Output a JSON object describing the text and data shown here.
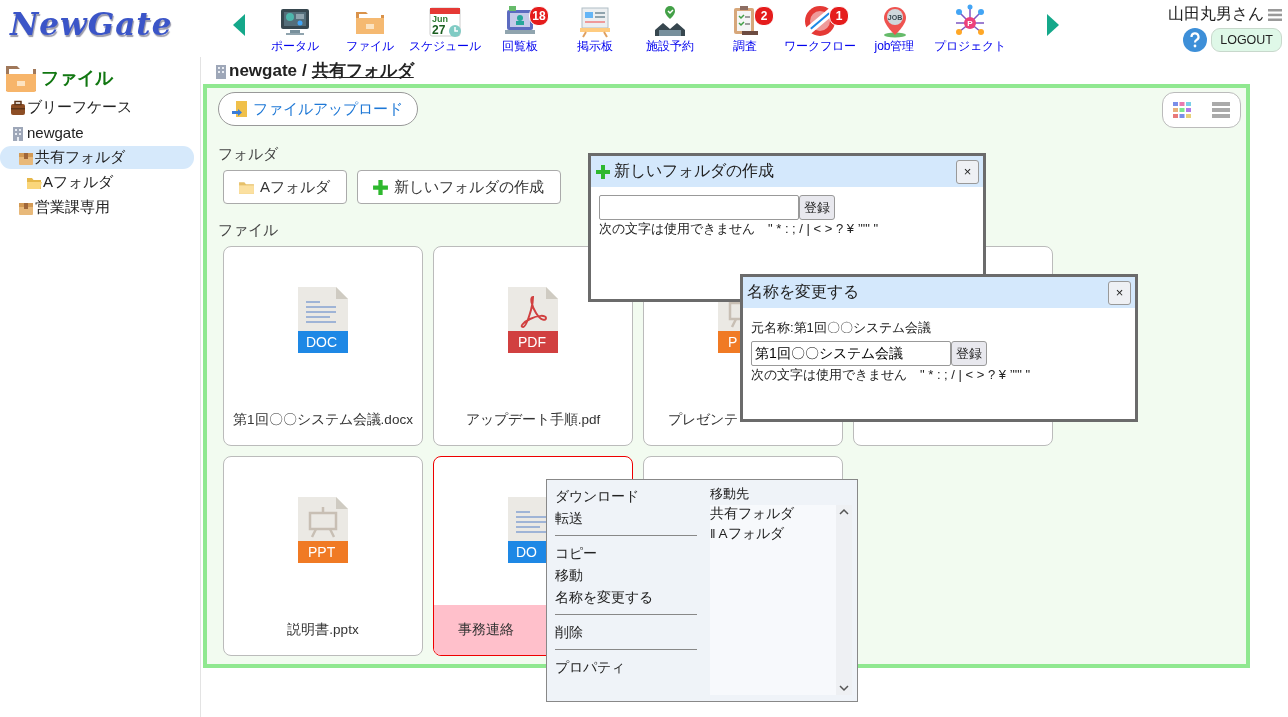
{
  "logo": "NewGate",
  "nav": {
    "items": [
      {
        "label": "ポータル",
        "kind": "portal"
      },
      {
        "label": "ファイル",
        "kind": "file"
      },
      {
        "label": "スケジュール",
        "kind": "calendar",
        "icon_text": [
          "Jun",
          "27"
        ]
      },
      {
        "label": "回覧板",
        "kind": "board",
        "badge": "18"
      },
      {
        "label": "掲示板",
        "kind": "bulletin"
      },
      {
        "label": "施設予約",
        "kind": "facility"
      },
      {
        "label": "調査",
        "kind": "survey",
        "badge": "2"
      },
      {
        "label": "ワークフロー",
        "kind": "stamp",
        "badge": "1"
      },
      {
        "label": "job管理",
        "kind": "pin",
        "icon_text": [
          "JOB"
        ]
      },
      {
        "label": "プロジェクト",
        "kind": "network",
        "icon_text": [
          "P"
        ]
      }
    ]
  },
  "user": {
    "name": "山田丸男さん",
    "logout": "LOGOUT"
  },
  "sidebar": {
    "title": "ファイル",
    "items": [
      {
        "label": "ブリーフケース",
        "kind": "briefcase",
        "selected": false
      },
      {
        "label": "newgate",
        "kind": "building",
        "selected": false,
        "children": [
          {
            "label": "共有フォルダ",
            "kind": "box",
            "selected": true,
            "children": [
              {
                "label": "Aフォルダ",
                "kind": "folder",
                "selected": false
              }
            ]
          },
          {
            "label": "営業課専用",
            "kind": "box",
            "selected": false
          }
        ]
      }
    ]
  },
  "breadcrumb": {
    "root": "newgate",
    "separator": "/",
    "current": "共有フォルダ"
  },
  "upload_button": "ファイルアップロード",
  "view_options": [
    {
      "kind": "grid",
      "selected": true
    },
    {
      "kind": "list",
      "selected": false
    }
  ],
  "folders": {
    "heading": "フォルダ",
    "items": [
      "Aフォルダ"
    ],
    "new_folder": "新しいフォルダの作成"
  },
  "files": {
    "heading": "ファイル",
    "items": [
      {
        "name": "第1回〇〇システム会議.docx",
        "kind": "doc",
        "badge": "DOC",
        "selected": false
      },
      {
        "name": "アップデート手順.pdf",
        "kind": "pdf",
        "badge": "PDF",
        "selected": false
      },
      {
        "name": "プレゼンテ",
        "kind": "ppt",
        "badge": "P",
        "selected": false,
        "clipped": true
      },
      {
        "selected": false
      },
      {
        "name": "説明書.pptx",
        "kind": "ppt",
        "badge": "PPT",
        "selected": false
      },
      {
        "name": "事務連絡",
        "kind": "doc",
        "badge": "DO",
        "selected": true,
        "clipped": true
      },
      {
        "selected": false
      }
    ]
  },
  "new_folder_dialog": {
    "title": "新しいフォルダの作成",
    "close": "×",
    "submit": "登録",
    "note": "次の文字は使用できません　\" * : ; / | < > ? ¥ ’\"\" \""
  },
  "rename_dialog": {
    "title": "名称を変更する",
    "close": "×",
    "original": "元名称:第1回〇〇システム会議",
    "value": "第1回〇〇システム会議",
    "submit": "登録",
    "note": "次の文字は使用できません　\" * : ; / | < > ? ¥ ’\"\" \""
  },
  "context_menu": {
    "groups": [
      [
        "ダウンロード",
        "転送"
      ],
      [
        "コピー",
        "移動",
        "名称を変更する"
      ],
      [
        "削除"
      ],
      [
        "プロパティ"
      ]
    ],
    "move_to": {
      "label": "移動先",
      "folders": [
        "共有フォルダ",
        "‖ Aフォルダ"
      ]
    }
  }
}
